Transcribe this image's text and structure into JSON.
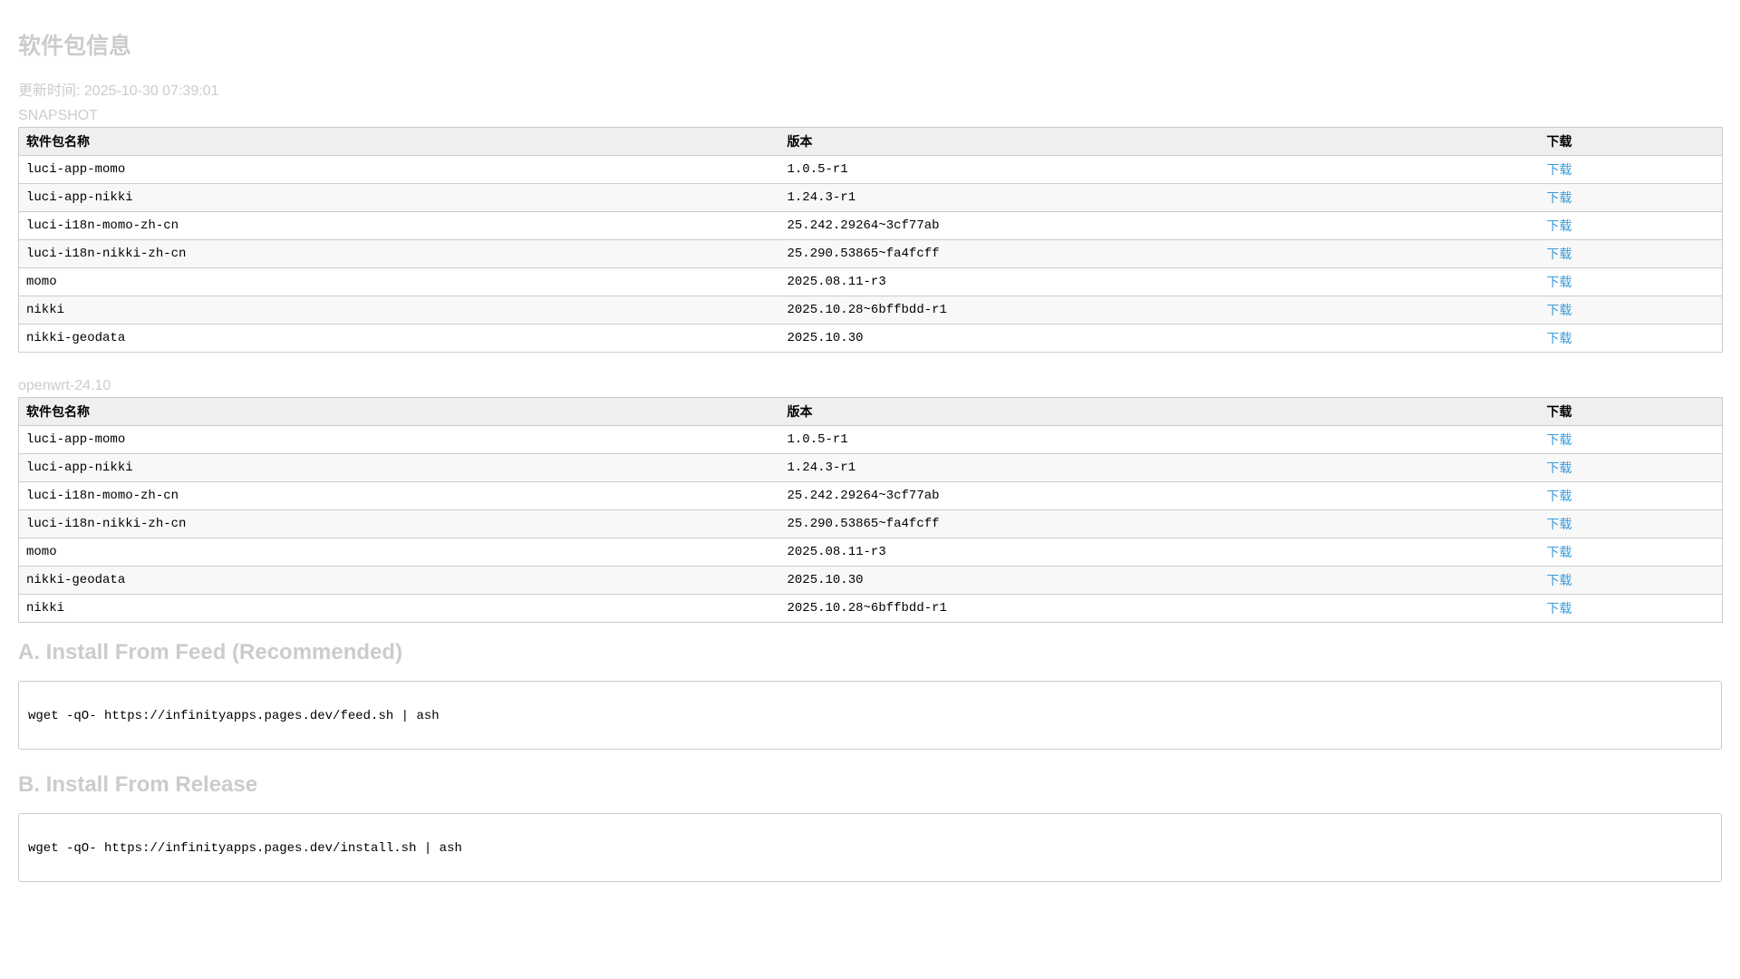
{
  "title": "软件包信息",
  "updated": "更新时间: 2025-10-30 07:39:01",
  "headers": {
    "name": "软件包名称",
    "version": "版本",
    "download": "下载"
  },
  "tables": [
    {
      "section": "SNAPSHOT",
      "rows": [
        {
          "name": "luci-app-momo",
          "version": "1.0.5-r1",
          "download": "下载"
        },
        {
          "name": "luci-app-nikki",
          "version": "1.24.3-r1",
          "download": "下载"
        },
        {
          "name": "luci-i18n-momo-zh-cn",
          "version": "25.242.29264~3cf77ab",
          "download": "下载"
        },
        {
          "name": "luci-i18n-nikki-zh-cn",
          "version": "25.290.53865~fa4fcff",
          "download": "下载"
        },
        {
          "name": "momo",
          "version": "2025.08.11-r3",
          "download": "下载"
        },
        {
          "name": "nikki",
          "version": "2025.10.28~6bffbdd-r1",
          "download": "下载"
        },
        {
          "name": "nikki-geodata",
          "version": "2025.10.30",
          "download": "下载"
        }
      ]
    },
    {
      "section": "openwrt-24.10",
      "rows": [
        {
          "name": "luci-app-momo",
          "version": "1.0.5-r1",
          "download": "下载"
        },
        {
          "name": "luci-app-nikki",
          "version": "1.24.3-r1",
          "download": "下载"
        },
        {
          "name": "luci-i18n-momo-zh-cn",
          "version": "25.242.29264~3cf77ab",
          "download": "下载"
        },
        {
          "name": "luci-i18n-nikki-zh-cn",
          "version": "25.290.53865~fa4fcff",
          "download": "下载"
        },
        {
          "name": "momo",
          "version": "2025.08.11-r3",
          "download": "下载"
        },
        {
          "name": "nikki-geodata",
          "version": "2025.10.30",
          "download": "下载"
        },
        {
          "name": "nikki",
          "version": "2025.10.28~6bffbdd-r1",
          "download": "下载"
        }
      ]
    }
  ],
  "install": [
    {
      "heading": "A. Install From Feed (Recommended)",
      "command": "wget -qO- https://infinityapps.pages.dev/feed.sh | ash"
    },
    {
      "heading": "B. Install From Release",
      "command": "wget -qO- https://infinityapps.pages.dev/install.sh | ash"
    }
  ],
  "colors": {
    "link": "#3a9ad9",
    "muted": "#cccccc"
  }
}
